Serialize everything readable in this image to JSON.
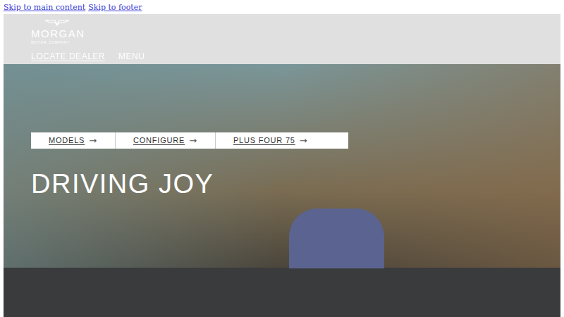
{
  "skip_links": [
    {
      "label": "Skip to main content"
    },
    {
      "label": "Skip to footer"
    }
  ],
  "logo": {
    "name": "MORGAN",
    "subtitle": "MOTOR COMPANY"
  },
  "nav": [
    {
      "label": "LOCATE DEALER",
      "selected": true
    },
    {
      "label": "MENU",
      "selected": false
    }
  ],
  "quick_links": [
    {
      "label": "MODELS",
      "arrow": "→"
    },
    {
      "label": "CONFIGURE",
      "arrow": "→"
    },
    {
      "label": "PLUS FOUR 75",
      "arrow": "→"
    }
  ],
  "hero": {
    "heading": "DRIVING JOY"
  }
}
